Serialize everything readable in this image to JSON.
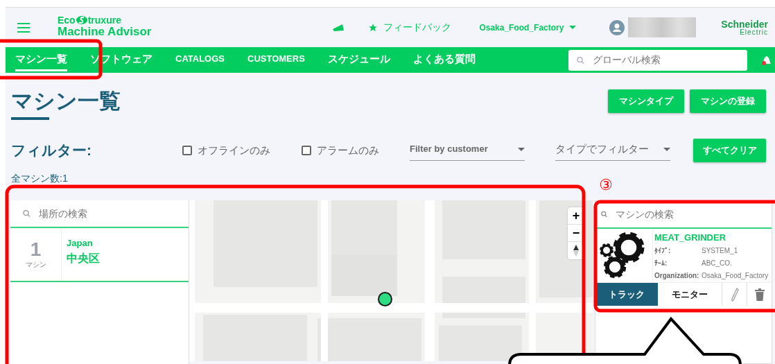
{
  "header": {
    "logo": {
      "prefix": "Eco",
      "suffix": "truxure",
      "product": "Machine Advisor"
    },
    "feedback": "フィードバック",
    "organization": "Osaka_Food_Factory",
    "brand": {
      "name": "Schneider",
      "sub": "Electric"
    }
  },
  "nav": [
    {
      "label": "マシン一覧",
      "selected": true
    },
    {
      "label": "ソフトウェア",
      "selected": false
    },
    {
      "label": "CATALOGS",
      "selected": false
    },
    {
      "label": "CUSTOMERS",
      "selected": false
    },
    {
      "label": "スケジュール",
      "selected": false
    },
    {
      "label": "よくある質問",
      "selected": false
    }
  ],
  "global_search": {
    "placeholder": "グローバル検索"
  },
  "page_title": "マシン一覧",
  "actions": [
    "マシンタイプ",
    "マシンの登録"
  ],
  "filter": {
    "label": "フィルター:",
    "checkboxes": [
      {
        "label": "オフラインのみ",
        "checked": false
      },
      {
        "label": "アラームのみ",
        "checked": false
      }
    ],
    "dropdowns": [
      {
        "placeholder": "Filter by customer",
        "kind": "latin"
      },
      {
        "placeholder": "タイプでフィルター",
        "kind": "plain"
      }
    ],
    "clear": "すべてクリア"
  },
  "total": "全マシン数:1",
  "locations": {
    "search": {
      "placeholder": "場所の検索"
    },
    "items": [
      {
        "count": "1",
        "unit": "マシン",
        "country": "Japan",
        "area": "中央区"
      }
    ]
  },
  "map": {
    "kind": "picture",
    "controls": [
      "+",
      "−"
    ]
  },
  "machines": {
    "search": {
      "placeholder": "マシンの検索"
    },
    "items": [
      {
        "name": "MEAT_GRINDER",
        "fields": [
          {
            "label": "ﾀｲﾌﾟ:",
            "value": "SYSTEM_1"
          },
          {
            "label": "ﾁｰﾑ:",
            "value": "ABC_CO."
          },
          {
            "label": "Organization:",
            "value": "Osaka_Food_Factory"
          }
        ],
        "actions": [
          {
            "label": "トラック",
            "selected": true
          },
          {
            "label": "モニター",
            "selected": false
          }
        ]
      }
    ]
  },
  "annotations": {
    "number": "③"
  }
}
